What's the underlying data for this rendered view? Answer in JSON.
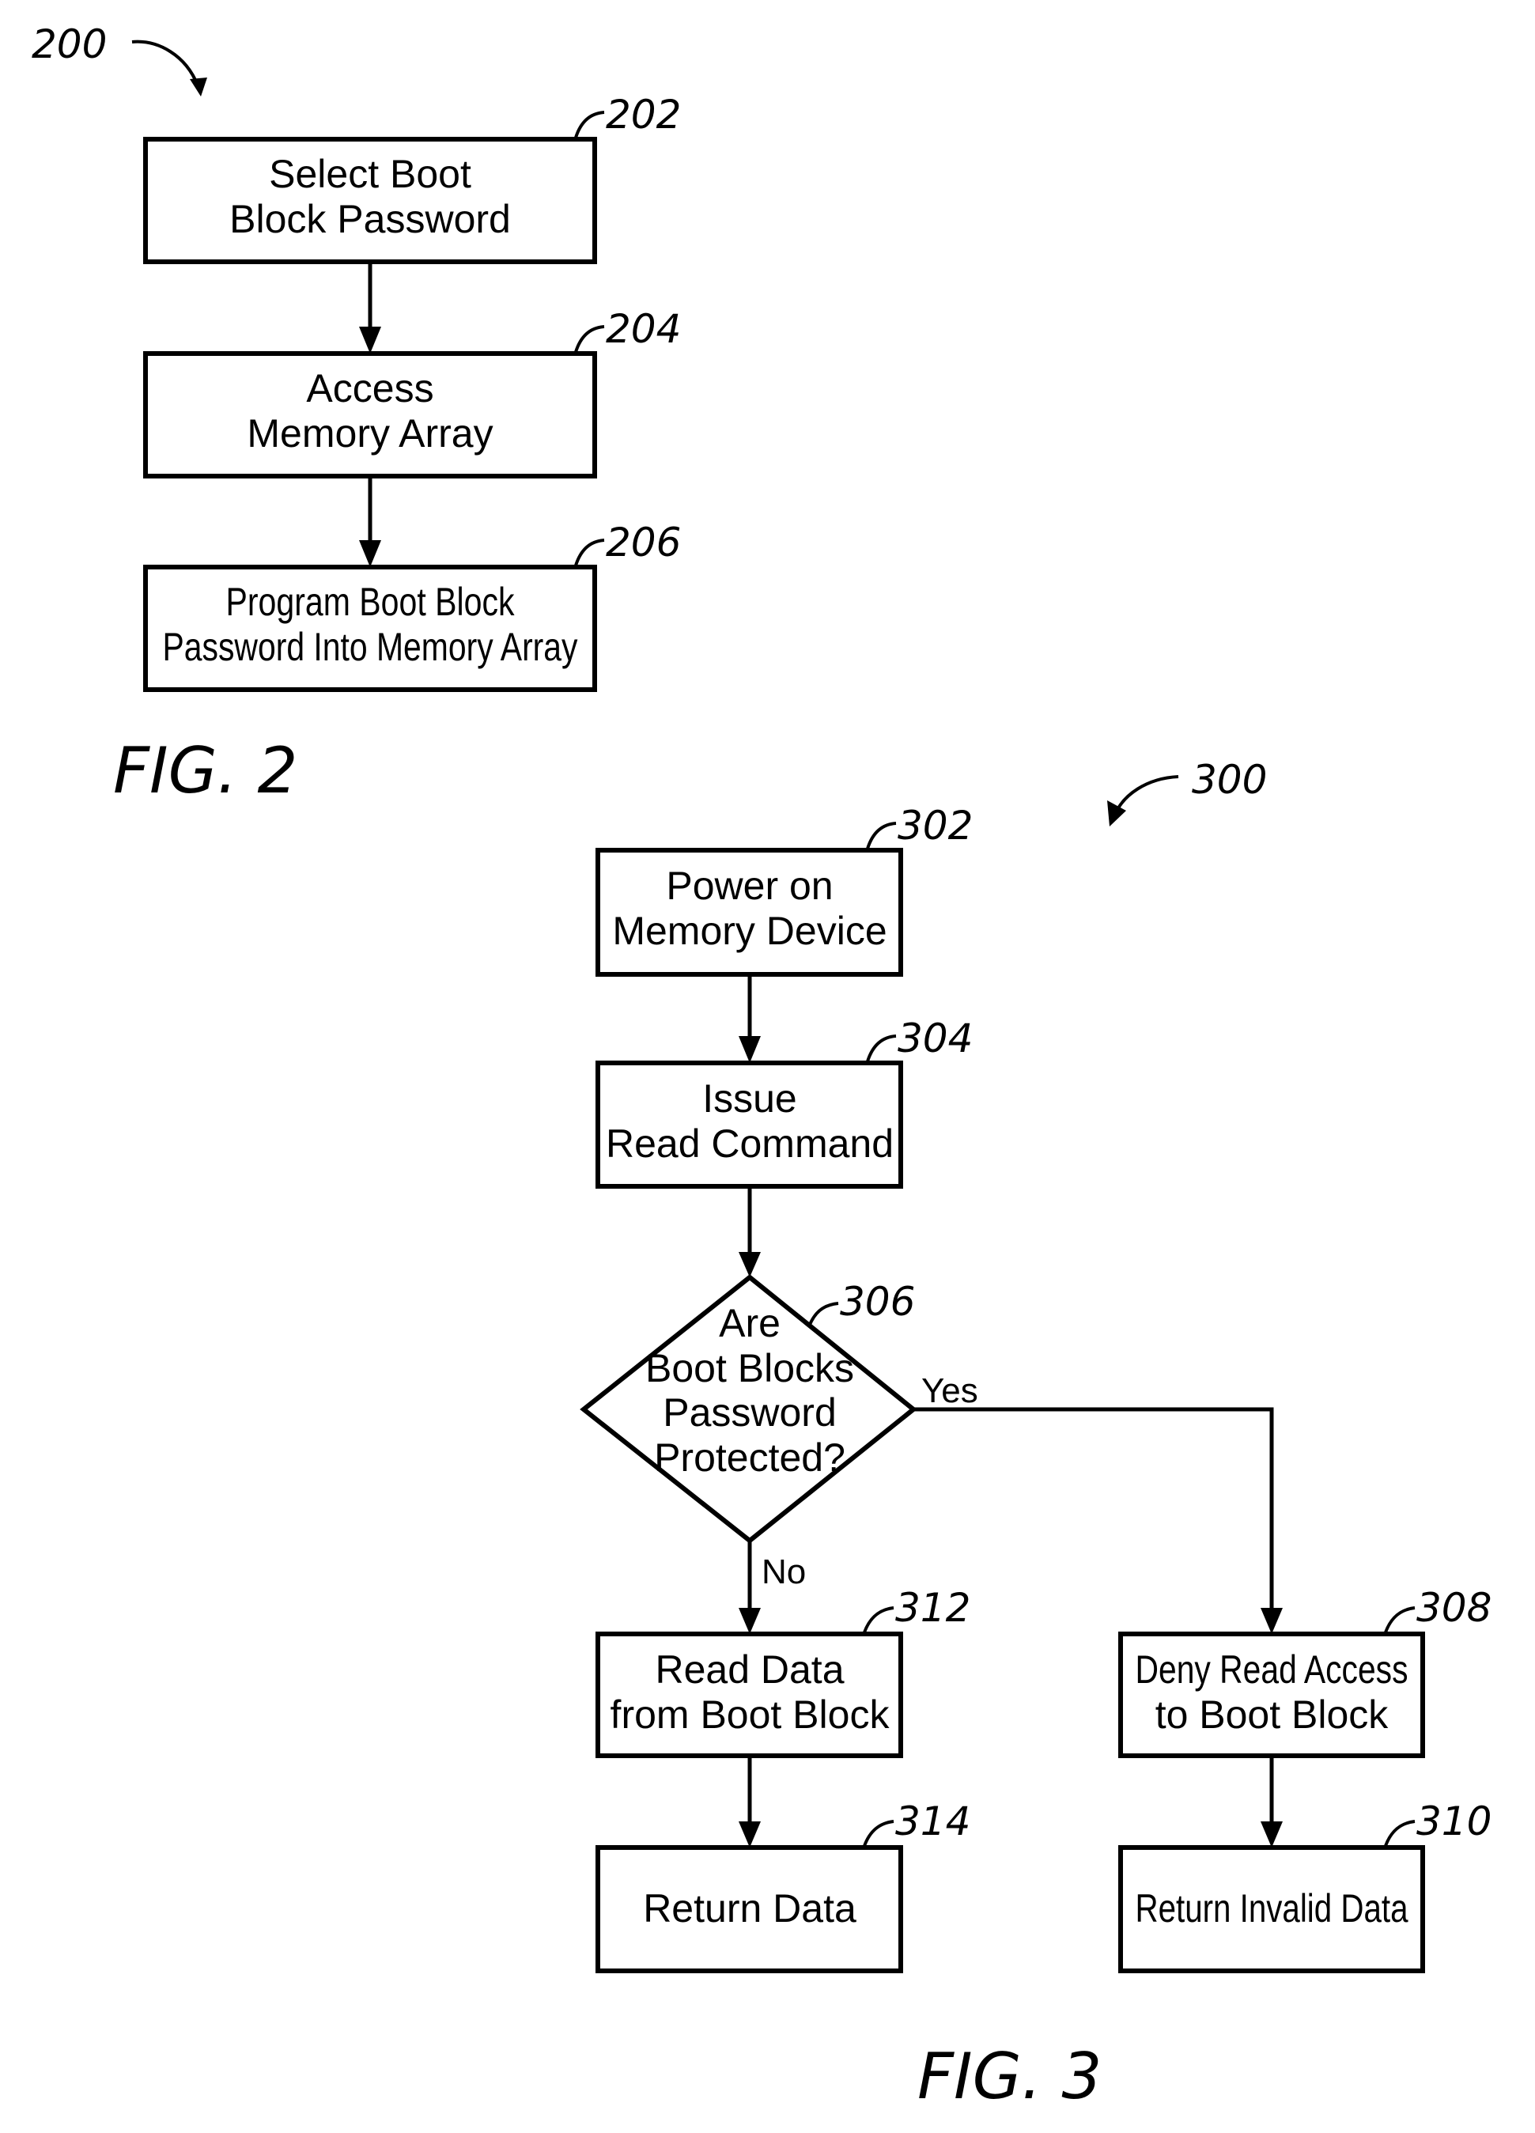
{
  "figures": [
    {
      "id": "fig2",
      "caption": "FIG. 2",
      "ref": "200",
      "steps": [
        {
          "ref": "202",
          "lines": [
            "Select Boot",
            "Block Password"
          ]
        },
        {
          "ref": "204",
          "lines": [
            "Access",
            "Memory Array"
          ]
        },
        {
          "ref": "206",
          "lines": [
            "Program Boot Block",
            "Password Into Memory Array"
          ]
        }
      ]
    },
    {
      "id": "fig3",
      "caption": "FIG. 3",
      "ref": "300",
      "steps": [
        {
          "ref": "302",
          "lines": [
            "Power on",
            "Memory Device"
          ]
        },
        {
          "ref": "304",
          "lines": [
            "Issue",
            "Read Command"
          ]
        },
        {
          "ref": "306",
          "type": "decision",
          "lines": [
            "Are",
            "Boot Blocks",
            "Password",
            "Protected?"
          ]
        },
        {
          "ref": "308",
          "lines": [
            "Deny Read Access",
            "to Boot Block"
          ]
        },
        {
          "ref": "310",
          "lines": [
            "Return Invalid Data"
          ]
        },
        {
          "ref": "312",
          "lines": [
            "Read Data",
            "from Boot Block"
          ]
        },
        {
          "ref": "314",
          "lines": [
            "Return Data"
          ]
        }
      ],
      "branches": {
        "yes": "Yes",
        "no": "No"
      }
    }
  ]
}
